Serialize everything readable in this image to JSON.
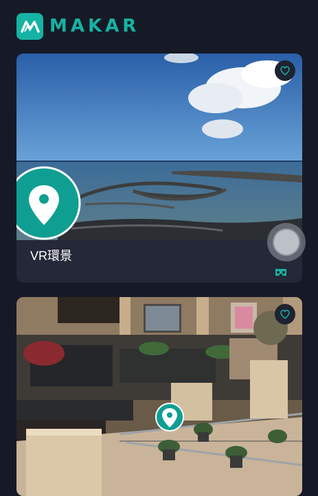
{
  "brand": {
    "name": "MAKAR",
    "logo_icon": "makar-logo-icon",
    "accent": "#16b3a4"
  },
  "cards": [
    {
      "title": "VR環景",
      "favorite_icon": "heart-icon",
      "type_icon": "vr-headset-icon"
    },
    {
      "title": "",
      "favorite_icon": "heart-icon"
    }
  ],
  "floating_button": {
    "icon": "assistive-touch-button"
  }
}
